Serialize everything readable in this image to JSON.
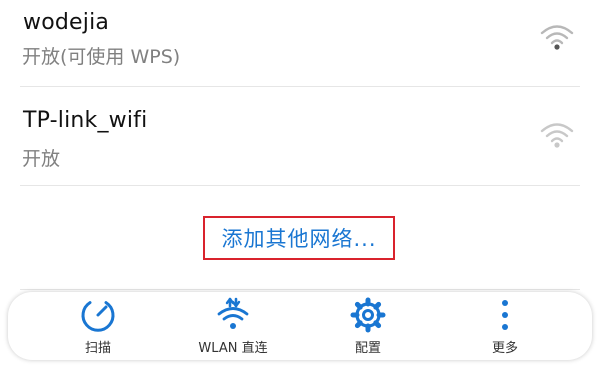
{
  "networks": [
    {
      "ssid": "wodejia",
      "status": "开放(可使用 WPS)",
      "signal_icon": "wifi-signal-icon"
    },
    {
      "ssid": "TP-link_wifi",
      "status": "开放",
      "signal_icon": "wifi-signal-icon"
    }
  ],
  "add_network_label": "添加其他网络...",
  "toolbar": {
    "items": [
      {
        "label": "扫描",
        "icon": "scan-icon"
      },
      {
        "label": "WLAN 直连",
        "icon": "wlan-direct-icon"
      },
      {
        "label": "配置",
        "icon": "gear-icon"
      },
      {
        "label": "更多",
        "icon": "more-vertical-icon"
      }
    ]
  },
  "colors": {
    "accent": "#1976d2",
    "highlight_border": "#d9232d",
    "secondary_text": "#808080"
  }
}
